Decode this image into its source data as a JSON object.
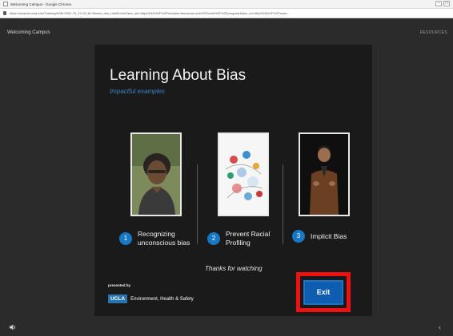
{
  "browser": {
    "title": "Welcoming Campus - Google Chrome",
    "url": "https://uclaehs.ucla.edu/Training/ASM-0001-75_12-02-18-3/index_lms_html5.html?aicc_sid=https%3A%2F%2Fwuclahs.lmscourse.edu%2Fcode%2F%2Fprogram&aicc_url=http%3A%2F%2Fwww...",
    "controls": [
      "–",
      "□"
    ]
  },
  "header": {
    "course_title": "Welcoming Campus",
    "right_text": "RESOURCES"
  },
  "slide": {
    "title": "Learning About Bias",
    "subtitle": "Impactful examples",
    "topics": [
      {
        "number": "1",
        "label": "Recognizing\nunconscious bias"
      },
      {
        "number": "2",
        "label": "Prevent Racial\nProfiling"
      },
      {
        "number": "3",
        "label": "Implicit Bias"
      }
    ],
    "thanks": "Thanks for watching",
    "presented_by": "presented by",
    "logo_box": "UCLA",
    "logo_dept": "Environment, Health & Safety",
    "exit_label": "Exit"
  },
  "colors": {
    "accent": "#1778c6",
    "highlight": "#ee1111",
    "slide_bg": "#1a1a1a",
    "page_bg": "#2b2b2b"
  },
  "icons": {
    "volume": "volume-icon",
    "back": "chevron-left-icon"
  }
}
